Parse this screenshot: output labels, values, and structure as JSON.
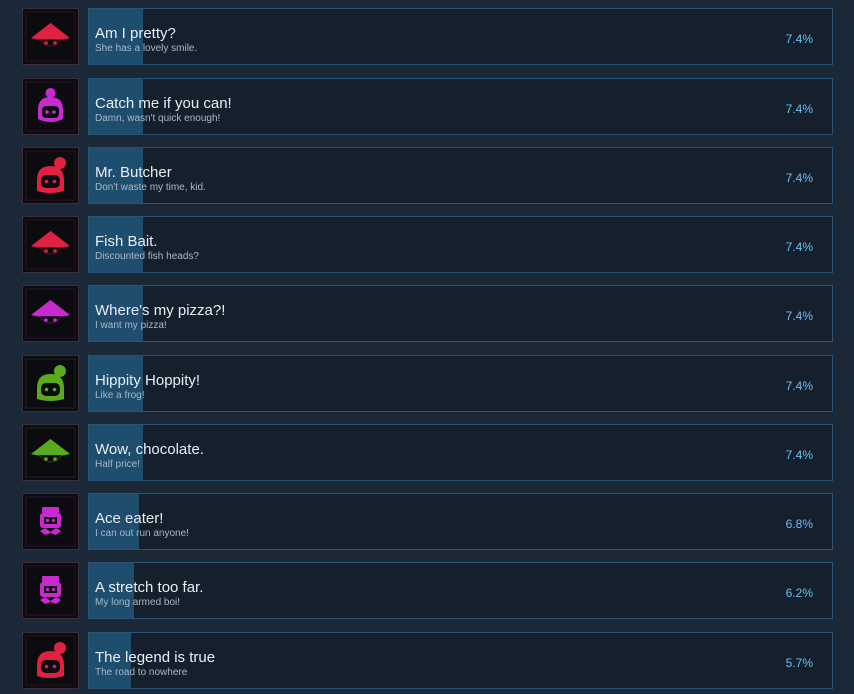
{
  "colors": {
    "background": "#1b2838",
    "bar_fill": "#1e4d6e",
    "bar_border": "#2a5477",
    "percent_text": "#66c0f4",
    "red": "#e0213f",
    "magenta": "#c92ad0",
    "green": "#5aaa1e"
  },
  "achievements": [
    {
      "title": "Am I pretty?",
      "description": "She has a lovely smile.",
      "percent_label": "7.4%",
      "percent_value": 7.4,
      "icon": "red-hat-icon",
      "icon_shape": "hat",
      "icon_color": "#e0213f"
    },
    {
      "title": "Catch me if you can!",
      "description": "Damn, wasn't quick enough!",
      "percent_label": "7.4%",
      "percent_value": 7.4,
      "icon": "magenta-bun-girl-icon",
      "icon_shape": "bun",
      "icon_color": "#c92ad0"
    },
    {
      "title": "Mr. Butcher",
      "description": "Don't waste my time, kid.",
      "percent_label": "7.4%",
      "percent_value": 7.4,
      "icon": "red-ponytail-girl-icon",
      "icon_shape": "ponytail",
      "icon_color": "#e0213f"
    },
    {
      "title": "Fish Bait.",
      "description": "Discounted fish heads?",
      "percent_label": "7.4%",
      "percent_value": 7.4,
      "icon": "red-hat-icon",
      "icon_shape": "hat",
      "icon_color": "#e0213f"
    },
    {
      "title": "Where's my pizza?!",
      "description": "I want my pizza!",
      "percent_label": "7.4%",
      "percent_value": 7.4,
      "icon": "magenta-hat-icon",
      "icon_shape": "hat",
      "icon_color": "#c92ad0"
    },
    {
      "title": "Hippity Hoppity!",
      "description": "Like a frog!",
      "percent_label": "7.4%",
      "percent_value": 7.4,
      "icon": "green-ponytail-girl-icon",
      "icon_shape": "ponytail",
      "icon_color": "#5aaa1e"
    },
    {
      "title": "Wow, chocolate.",
      "description": "Half price!",
      "percent_label": "7.4%",
      "percent_value": 7.4,
      "icon": "green-hat-icon",
      "icon_shape": "hat",
      "icon_color": "#5aaa1e"
    },
    {
      "title": "Ace eater!",
      "description": "I can out run anyone!",
      "percent_label": "6.8%",
      "percent_value": 6.8,
      "icon": "magenta-robot-icon",
      "icon_shape": "robot",
      "icon_color": "#c92ad0"
    },
    {
      "title": "A stretch too far.",
      "description": "My long armed boi!",
      "percent_label": "6.2%",
      "percent_value": 6.2,
      "icon": "magenta-robot-icon",
      "icon_shape": "robot",
      "icon_color": "#c92ad0"
    },
    {
      "title": "The legend is true",
      "description": "The road to nowhere",
      "percent_label": "5.7%",
      "percent_value": 5.7,
      "icon": "red-ponytail-girl-icon",
      "icon_shape": "ponytail",
      "icon_color": "#e0213f"
    }
  ]
}
